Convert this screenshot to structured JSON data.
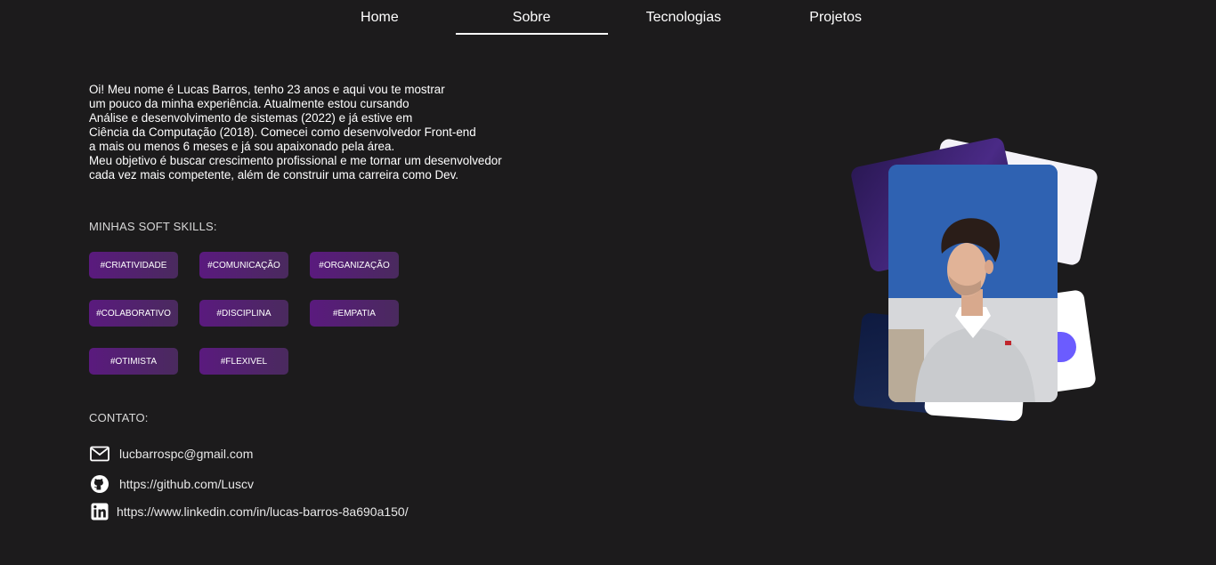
{
  "nav": {
    "items": [
      {
        "label": "Home",
        "active": false
      },
      {
        "label": "Sobre",
        "active": true
      },
      {
        "label": "Tecnologias",
        "active": false
      },
      {
        "label": "Projetos",
        "active": false
      }
    ]
  },
  "about": {
    "lines": [
      "Oi! Meu nome é Lucas Barros, tenho 23 anos e aqui vou te mostrar",
      "um pouco da minha experiência. Atualmente estou cursando",
      "Análise e desenvolvimento de sistemas (2022) e já estive em",
      "Ciência da Computação (2018). Comecei como desenvolvedor Front-end",
      "a mais ou menos 6 meses e já sou apaixonado pela área.",
      "Meu objetivo é buscar crescimento profissional e me tornar um desenvolvedor",
      "cada vez mais competente, além de construir uma carreira como Dev."
    ]
  },
  "skills": {
    "title": "MINHAS SOFT SKILLS:",
    "items": [
      "#CRIATIVIDADE",
      "#COMUNICAÇÃO",
      "#ORGANIZAÇÃO",
      "#COLABORATIVO",
      "#DISCIPLINA",
      "#EMPATIA",
      "#OTIMISTA",
      "#FLEXIVEL"
    ]
  },
  "contact": {
    "title": "CONTATO:",
    "email": {
      "text": "lucbarrospc@gmail.com",
      "icon": "mail-icon"
    },
    "github": {
      "text": "https://github.com/Luscv",
      "icon": "github-icon"
    },
    "linkedin": {
      "text": "https://www.linkedin.com/in/lucas-barros-8a690a150/",
      "icon": "linkedin-icon"
    }
  },
  "colors": {
    "background": "#1c1b1c",
    "skill_tag": "#5a1a7e",
    "text": "#ffffff"
  }
}
